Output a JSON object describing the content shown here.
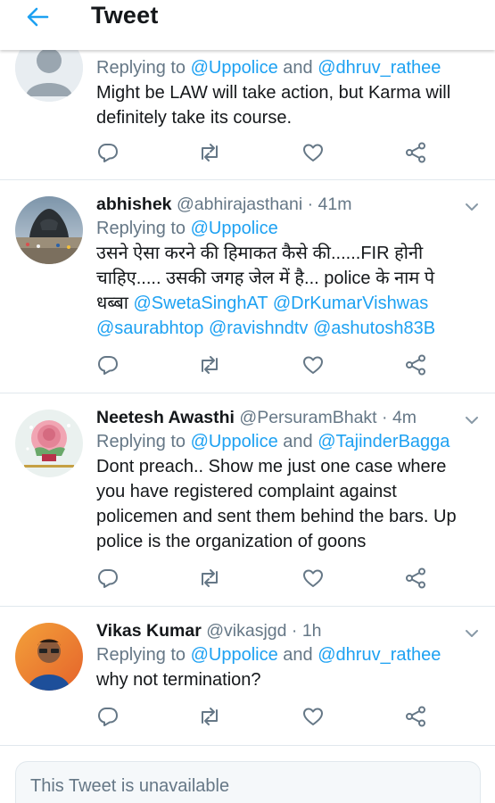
{
  "header": {
    "title": "Tweet"
  },
  "tweets": [
    {
      "name": "",
      "handle": "",
      "time": "",
      "replying_prefix": "Replying to",
      "replying_to": [
        {
          "text": "@Uppolice",
          "link": true
        },
        {
          "text": " and ",
          "link": false
        },
        {
          "text": "@dhruv_rathee",
          "link": true
        }
      ],
      "body": [
        [
          {
            "text": "Might be LAW will take action, but Karma will",
            "link": false
          }
        ],
        [
          {
            "text": "definitely take its course.",
            "link": false
          }
        ]
      ]
    },
    {
      "name": "abhishek",
      "handle": "@abhirajasthani",
      "time": "41m",
      "replying_prefix": "Replying to",
      "replying_to": [
        {
          "text": "@Uppolice",
          "link": true
        }
      ],
      "body": [
        [
          {
            "text": "उसने ऐसा करने की हिमाकत कैसे की......FIR होनी",
            "link": false
          }
        ],
        [
          {
            "text": "चाहिए..... उसकी जगह जेल में है... police के नाम पे",
            "link": false
          }
        ],
        [
          {
            "text": "धब्बा ",
            "link": false
          },
          {
            "text": "@SwetaSinghAT",
            "link": true
          },
          {
            "text": " ",
            "link": false
          },
          {
            "text": "@DrKumarVishwas",
            "link": true
          }
        ],
        [
          {
            "text": "@saurabhtop",
            "link": true
          },
          {
            "text": " ",
            "link": false
          },
          {
            "text": "@ravishndtv",
            "link": true
          },
          {
            "text": " ",
            "link": false
          },
          {
            "text": "@ashutosh83B",
            "link": true
          }
        ]
      ]
    },
    {
      "name": "Neetesh Awasthi",
      "handle": "@PersuramBhakt",
      "time": "4m",
      "replying_prefix": "Replying to",
      "replying_to": [
        {
          "text": "@Uppolice",
          "link": true
        },
        {
          "text": " and ",
          "link": false
        },
        {
          "text": "@TajinderBagga",
          "link": true
        }
      ],
      "body": [
        [
          {
            "text": "Dont preach.. Show me just one case where",
            "link": false
          }
        ],
        [
          {
            "text": "you have registered complaint against",
            "link": false
          }
        ],
        [
          {
            "text": "policemen and sent them behind the bars. Up",
            "link": false
          }
        ],
        [
          {
            "text": "police is the organization of goons",
            "link": false
          }
        ]
      ]
    },
    {
      "name": "Vikas Kumar",
      "handle": "@vikasjgd",
      "time": "1h",
      "replying_prefix": "Replying to",
      "replying_to": [
        {
          "text": "@Uppolice",
          "link": true
        },
        {
          "text": " and ",
          "link": false
        },
        {
          "text": "@dhruv_rathee",
          "link": true
        }
      ],
      "body": [
        [
          {
            "text": "why not termination?",
            "link": false
          }
        ]
      ]
    }
  ],
  "unavailable": {
    "text": "This Tweet is unavailable"
  },
  "icons": {
    "back": "arrow-left-icon",
    "reply": "reply-icon",
    "retweet": "retweet-icon",
    "like": "heart-icon",
    "share": "share-icon",
    "more": "chevron-down-icon"
  },
  "colors": {
    "accent": "#1da1f2",
    "secondary_text": "#657786",
    "primary_text": "#14171a",
    "divider": "#e1e8ed"
  }
}
